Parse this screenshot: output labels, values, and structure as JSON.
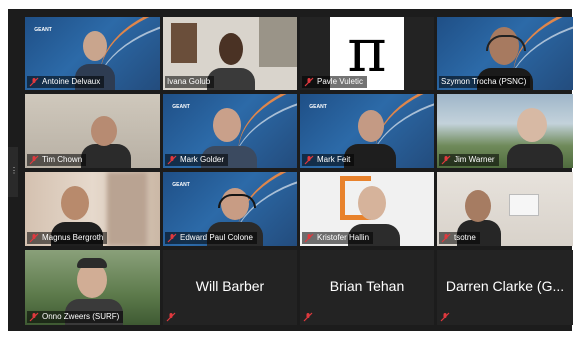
{
  "participants": [
    {
      "name": "Antoine Delvaux",
      "muted": true,
      "video": true
    },
    {
      "name": "Ivana Golub",
      "muted": false,
      "video": true
    },
    {
      "name": "Pavle Vuletic",
      "muted": true,
      "video": true,
      "avatar_symbol": "π"
    },
    {
      "name": "Szymon Trocha (PSNC)",
      "muted": false,
      "video": true,
      "speaking": true
    },
    {
      "name": "Tim Chown",
      "muted": true,
      "video": true
    },
    {
      "name": "Mark Golder",
      "muted": true,
      "video": true
    },
    {
      "name": "Mark Feit",
      "muted": true,
      "video": true
    },
    {
      "name": "Jim Warner",
      "muted": true,
      "video": true
    },
    {
      "name": "Magnus Bergroth",
      "muted": true,
      "video": true
    },
    {
      "name": "Edward Paul Colone",
      "muted": true,
      "video": true
    },
    {
      "name": "Kristofer Hallin",
      "muted": true,
      "video": true
    },
    {
      "name": "tsotne",
      "muted": true,
      "video": true
    },
    {
      "name": "Onno Zweers (SURF)",
      "muted": true,
      "video": true
    },
    {
      "name": "Will Barber",
      "muted": true,
      "video": false
    },
    {
      "name": "Brian Tehan",
      "muted": true,
      "video": false
    },
    {
      "name": "Darren Clarke (G...",
      "muted": true,
      "video": false
    }
  ],
  "colors": {
    "speaking_border": "#cbe35a",
    "muted_icon": "#e0393e",
    "tile_background": "#232323"
  },
  "icons": {
    "muted": "microphone-muted-icon",
    "handle": "sidebar-handle-icon"
  }
}
